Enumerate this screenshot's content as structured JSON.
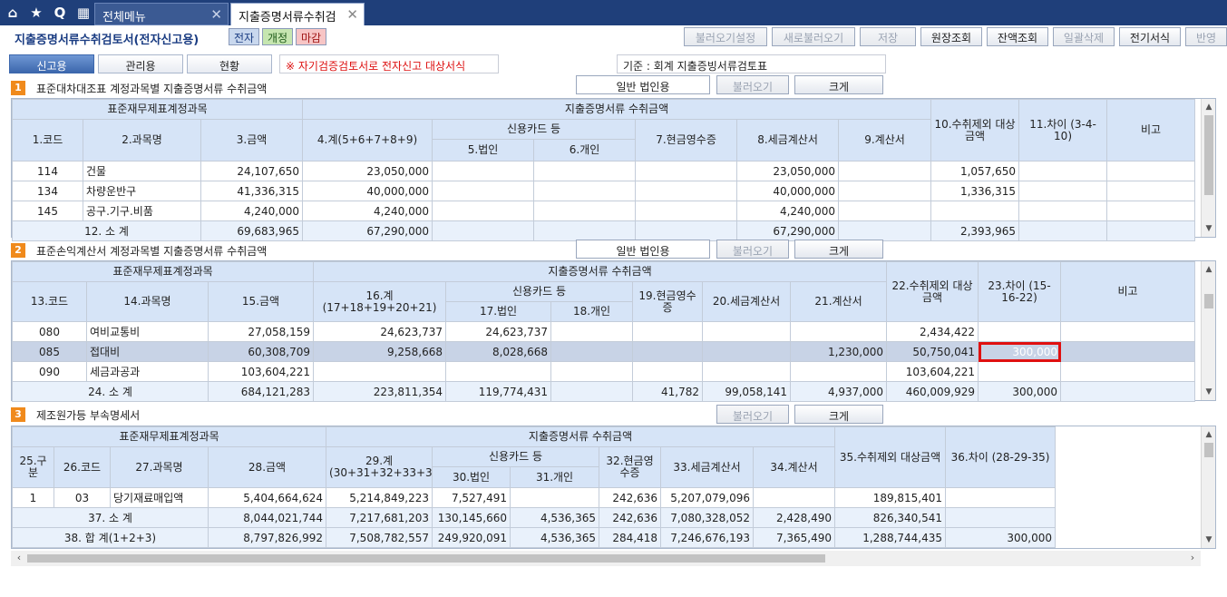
{
  "topbar": {
    "menu_tab": "전체메뉴",
    "active_tab": "지출증명서류수취검"
  },
  "header": {
    "title": "지출증명서류수취검토서(전자신고용)",
    "badges": [
      "전자",
      "개정",
      "마감"
    ],
    "buttons": [
      "불러오기설정",
      "새로불러오기",
      "저장",
      "원장조회",
      "잔액조회",
      "일괄삭제",
      "전기서식",
      "반영"
    ]
  },
  "subtabs": [
    "신고용",
    "관리용",
    "현황"
  ],
  "notice": "※ 자기검증검토서로 전자신고 대상서식",
  "basis": "기준 : 회계 지출증빙서류검토표",
  "section1": {
    "num": "1",
    "title": "표준대차대조표 계정과목별 지출증명서류 수취금액",
    "type_value": "일반 법인용",
    "load_btn": "불러오기",
    "zoom_btn": "크게",
    "headers": {
      "group_left": "표준재무제표계정과목",
      "group_right": "지출증명서류 수취금액",
      "card": "신용카드 등",
      "cols": [
        "1.코드",
        "2.과목명",
        "3.금액",
        "4.계(5+6+7+8+9)",
        "5.법인",
        "6.개인",
        "7.현금영수증",
        "8.세금계산서",
        "9.계산서",
        "10.수취제외 대상금액",
        "11.차이 (3-4-10)",
        "비고"
      ]
    },
    "rows": [
      [
        "114",
        "건물",
        "24,107,650",
        "23,050,000",
        "",
        "",
        "",
        "23,050,000",
        "",
        "1,057,650",
        "",
        ""
      ],
      [
        "134",
        "차량운반구",
        "41,336,315",
        "40,000,000",
        "",
        "",
        "",
        "40,000,000",
        "",
        "1,336,315",
        "",
        ""
      ],
      [
        "145",
        "공구.기구.비품",
        "4,240,000",
        "4,240,000",
        "",
        "",
        "",
        "4,240,000",
        "",
        "",
        "",
        ""
      ]
    ],
    "subtotal": {
      "label": "12. 소    계",
      "values": [
        "69,683,965",
        "67,290,000",
        "",
        "",
        "",
        "67,290,000",
        "",
        "2,393,965",
        "",
        ""
      ]
    }
  },
  "section2": {
    "num": "2",
    "title": "표준손익계산서 계정과목별 지출증명서류 수취금액",
    "type_value": "일반 법인용",
    "load_btn": "불러오기",
    "zoom_btn": "크게",
    "headers": {
      "group_left": "표준재무제표계정과목",
      "group_right": "지출증명서류 수취금액",
      "card": "신용카드 등",
      "cols": [
        "13.코드",
        "14.과목명",
        "15.금액",
        "16.계(17+18+19+20+21)",
        "17.법인",
        "18.개인",
        "19.현금영수증",
        "20.세금계산서",
        "21.계산서",
        "22.수취제외 대상금액",
        "23.차이 (15-16-22)",
        "비고"
      ]
    },
    "rows": [
      [
        "080",
        "여비교통비",
        "27,058,159",
        "24,623,737",
        "24,623,737",
        "",
        "",
        "",
        "",
        "2,434,422",
        "",
        ""
      ],
      [
        "085",
        "접대비",
        "60,308,709",
        "9,258,668",
        "8,028,668",
        "",
        "",
        "",
        "1,230,000",
        "50,750,041",
        "300,000",
        ""
      ],
      [
        "090",
        "세금과공과",
        "103,604,221",
        "",
        "",
        "",
        "",
        "",
        "",
        "103,604,221",
        "",
        ""
      ]
    ],
    "subtotal": {
      "label": "24. 소    계",
      "values": [
        "684,121,283",
        "223,811,354",
        "119,774,431",
        "",
        "41,782",
        "99,058,141",
        "4,937,000",
        "460,009,929",
        "300,000",
        ""
      ]
    }
  },
  "section3": {
    "num": "3",
    "title": "제조원가등 부속명세서",
    "load_btn": "불러오기",
    "zoom_btn": "크게",
    "headers": {
      "group_left": "표준재무제표계정과목",
      "group_right": "지출증명서류 수취금액",
      "card": "신용카드 등",
      "cols": [
        "25.구분",
        "26.코드",
        "27.과목명",
        "28.금액",
        "29.계 (30+31+32+33+34)",
        "30.법인",
        "31.개인",
        "32.현금영수증",
        "33.세금계산서",
        "34.계산서",
        "35.수취제외 대상금액",
        "36.차이 (28-29-35)"
      ]
    },
    "rows": [
      [
        "1",
        "03",
        "당기재료매입액",
        "5,404,664,624",
        "5,214,849,223",
        "7,527,491",
        "",
        "242,636",
        "5,207,079,096",
        "",
        "189,815,401",
        ""
      ]
    ],
    "subtotal": {
      "label": "37. 소    계",
      "values": [
        "8,044,021,744",
        "7,217,681,203",
        "130,145,660",
        "4,536,365",
        "242,636",
        "7,080,328,052",
        "2,428,490",
        "826,340,541",
        ""
      ]
    },
    "total": {
      "label": "38. 합    계(1+2+3)",
      "values": [
        "8,797,826,992",
        "7,508,782,557",
        "249,920,091",
        "4,536,365",
        "284,418",
        "7,246,676,193",
        "7,365,490",
        "1,288,744,435",
        "300,000"
      ]
    }
  }
}
